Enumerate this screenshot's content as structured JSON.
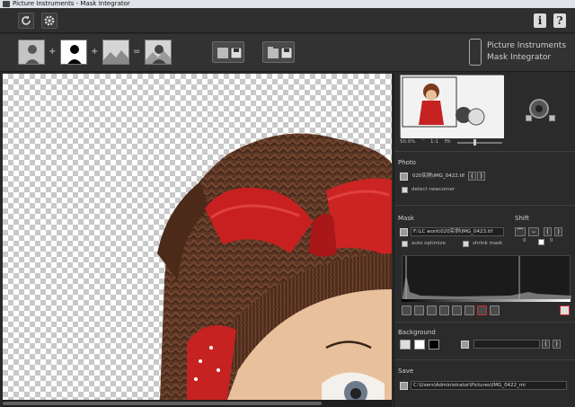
{
  "window": {
    "title": "Picture Instruments - Mask Integrator"
  },
  "toolbar": {
    "reset_icon": "rotate-icon",
    "settings_icon": "gear-icon",
    "info_label": "i",
    "help_label": "?"
  },
  "modes": {
    "plus": "+",
    "equals": "="
  },
  "brand": {
    "line1": "Picture Instruments",
    "line2": "Mask Integrator"
  },
  "navigator": {
    "zoom": "50.0%",
    "ratio": "1:1",
    "fit": "Fit"
  },
  "photo": {
    "title": "Photo",
    "filename": "020实例\\IMG_0422.tif",
    "prev": "(",
    "next": ")",
    "detect_newcomer": "detect newcomer"
  },
  "mask": {
    "title": "Mask",
    "filename": "F:\\LC work\\020实例\\IMG_0423.tif",
    "auto_optimize": "auto optimize",
    "shrink_mask": "shrink mask",
    "shift_label": "Shift",
    "shift_a": "0",
    "shift_b": "0",
    "prev": "(",
    "next": ")"
  },
  "background": {
    "title": "Background",
    "prev": "(",
    "next": ")"
  },
  "save": {
    "title": "Save",
    "path": "C:\\Users\\Administrator\\Pictures\\IMG_0422_mi"
  },
  "colors": {
    "panel": "#2b2b2b",
    "red_accent": "#d12a2a",
    "text": "#d0d0d0"
  }
}
